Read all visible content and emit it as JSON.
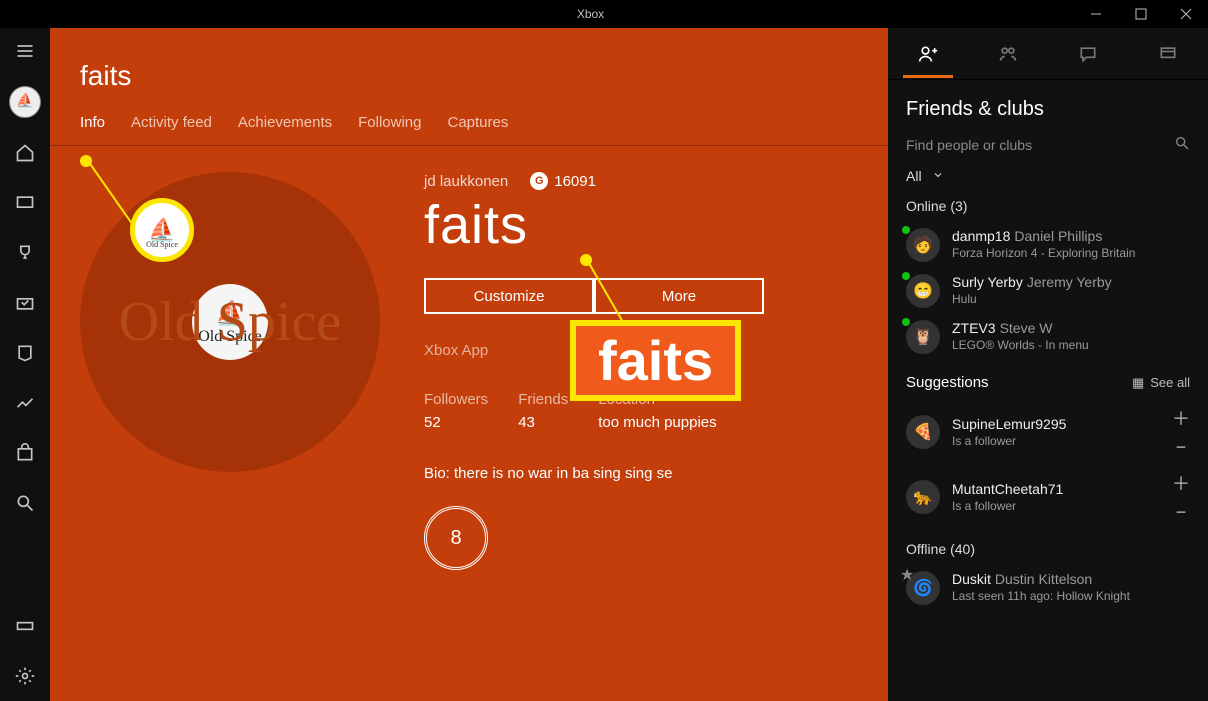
{
  "titlebar": {
    "title": "Xbox"
  },
  "profile": {
    "username_header": "faits",
    "tabs": [
      "Info",
      "Activity feed",
      "Achievements",
      "Following",
      "Captures"
    ],
    "active_tab": 0,
    "real_name": "jd laukkonen",
    "gamerscore": "16091",
    "gamertag": "faits",
    "actions": {
      "customize": "Customize",
      "more": "More"
    },
    "sub_app": "Xbox App",
    "stats": {
      "followers_label": "Followers",
      "followers": "52",
      "friends_label": "Friends",
      "friends": "43",
      "location_label": "Location",
      "location": "too much puppies"
    },
    "bio": "Bio: there is no war in ba sing sing se",
    "tenure": "8"
  },
  "annotation": {
    "box_text": "faits"
  },
  "side": {
    "header": "Friends & clubs",
    "search_placeholder": "Find people or clubs",
    "filter": "All",
    "online_header": "Online (3)",
    "online": [
      {
        "tag": "danmp18",
        "real": "Daniel Phillips",
        "status": "Forza Horizon 4 - Exploring Britain"
      },
      {
        "tag": "Surly Yerby",
        "real": "Jeremy Yerby",
        "status": "Hulu"
      },
      {
        "tag": "ZTEV3",
        "real": "Steve W",
        "status": "LEGO® Worlds - In menu"
      }
    ],
    "suggestions_header": "Suggestions",
    "see_all": "See all",
    "suggestions": [
      {
        "tag": "SupineLemur9295",
        "status": "Is a follower"
      },
      {
        "tag": "MutantCheetah71",
        "status": "Is a follower"
      }
    ],
    "offline_header": "Offline (40)",
    "offline": [
      {
        "tag": "Duskit",
        "real": "Dustin Kittelson",
        "status": "Last seen 11h ago: Hollow Knight"
      }
    ]
  }
}
